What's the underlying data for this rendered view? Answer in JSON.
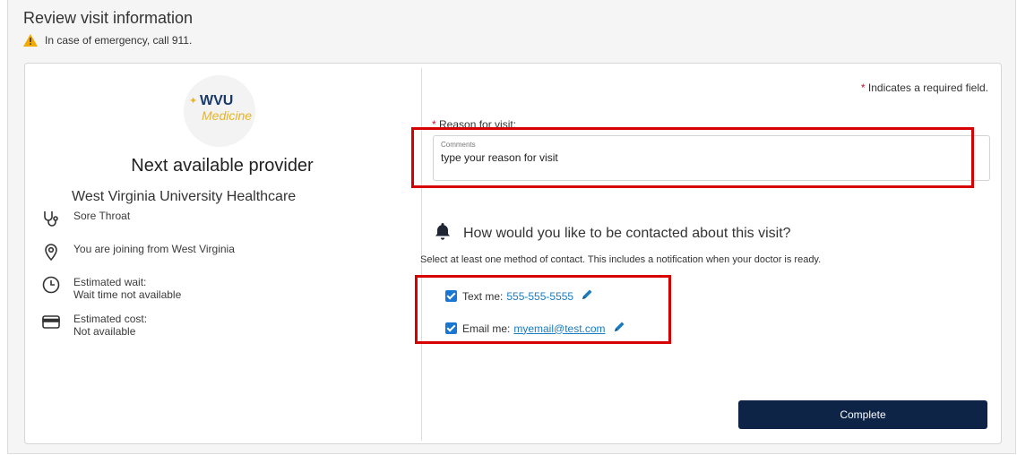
{
  "page": {
    "title": "Review visit information",
    "emergency_text": "In case of emergency, call 911."
  },
  "provider": {
    "logo_top": "WVU",
    "logo_bottom": "Medicine",
    "name": "Next available provider",
    "organization": "West Virginia University Healthcare"
  },
  "visit_info": {
    "symptom": "Sore Throat",
    "location": "You are joining from West Virginia",
    "wait_label": "Estimated wait:",
    "wait_value": "Wait time not available",
    "cost_label": "Estimated cost:",
    "cost_value": "Not available"
  },
  "form": {
    "required_star": "*",
    "required_note": "Indicates a required field.",
    "reason_label": "Reason for visit:",
    "comments_label": "Comments",
    "reason_value": "type your reason for visit"
  },
  "contact": {
    "heading": "How would you like to be contacted about this visit?",
    "subtext": "Select at least one method of contact. This includes a notification when your doctor is ready.",
    "text_label": "Text me:",
    "text_value": "555-555-5555",
    "email_label": "Email me:",
    "email_value": "myemail@test.com"
  },
  "actions": {
    "complete_label": "Complete"
  },
  "colors": {
    "accent_blue": "#1976d2",
    "button_navy": "#0d2447",
    "highlight_red": "#d60000",
    "required_red": "#c8102e"
  }
}
